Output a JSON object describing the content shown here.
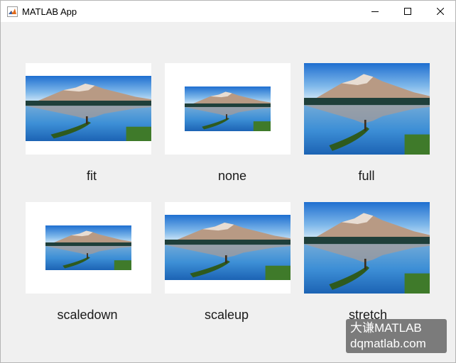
{
  "window": {
    "title": "MATLAB App"
  },
  "icons": {
    "app": "matlab-logo-icon",
    "minimize": "minimize-icon",
    "maximize": "maximize-icon",
    "close": "close-icon"
  },
  "images": [
    {
      "caption": "fit"
    },
    {
      "caption": "none"
    },
    {
      "caption": "full"
    },
    {
      "caption": "scaledown"
    },
    {
      "caption": "scaleup"
    },
    {
      "caption": "stretch"
    }
  ],
  "watermark": {
    "line1": "大谦MATLAB",
    "line2": "dqmatlab.com"
  }
}
